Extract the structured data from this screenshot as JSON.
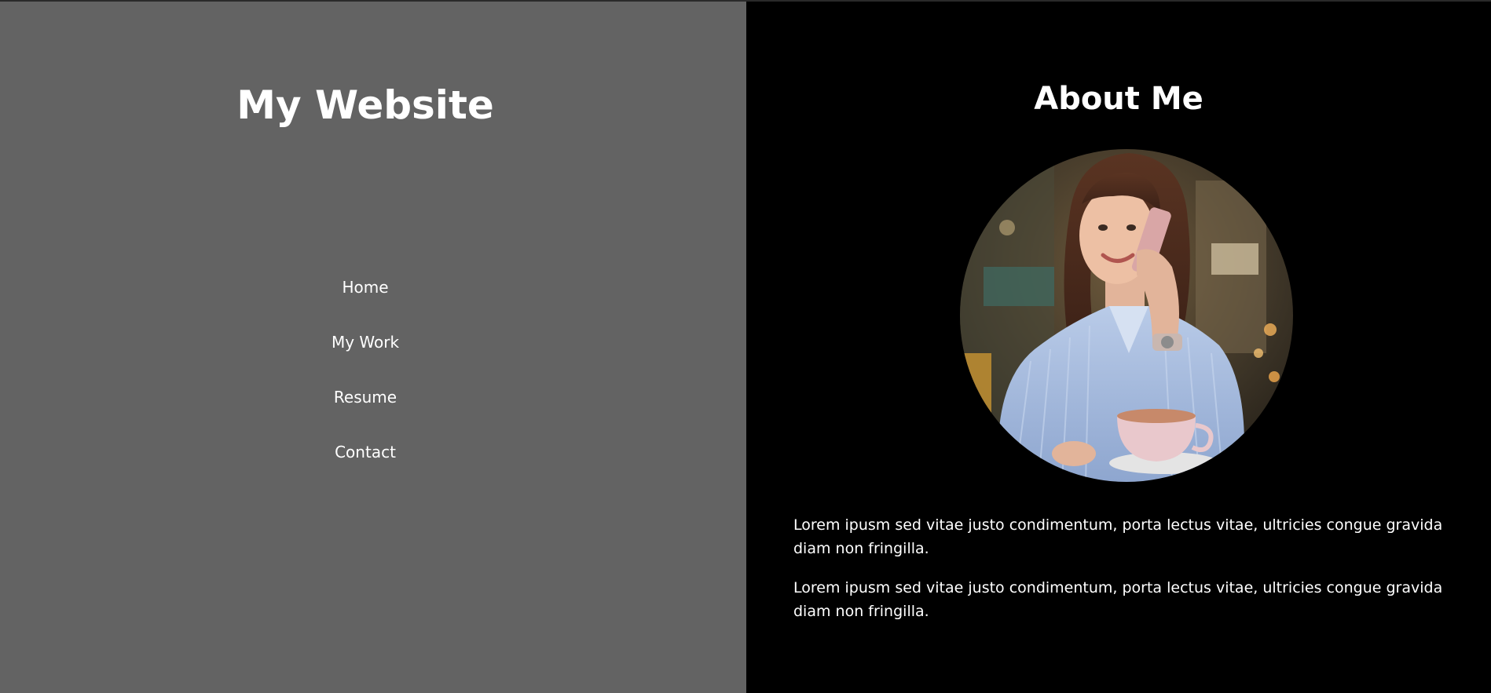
{
  "sidebar": {
    "title": "My Website",
    "nav": [
      {
        "label": "Home"
      },
      {
        "label": "My Work"
      },
      {
        "label": "Resume"
      },
      {
        "label": "Contact"
      }
    ]
  },
  "about": {
    "title": "About Me",
    "paragraphs": [
      "Lorem ipusm sed vitae justo condimentum, porta lectus vitae, ultricies congue gravida diam non fringilla.",
      "Lorem ipusm sed vitae justo condimentum, porta lectus vitae, ultricies congue gravida diam non fringilla."
    ]
  },
  "colors": {
    "sidebar_bg": "#636363",
    "content_bg": "#000000",
    "text": "#ffffff"
  }
}
